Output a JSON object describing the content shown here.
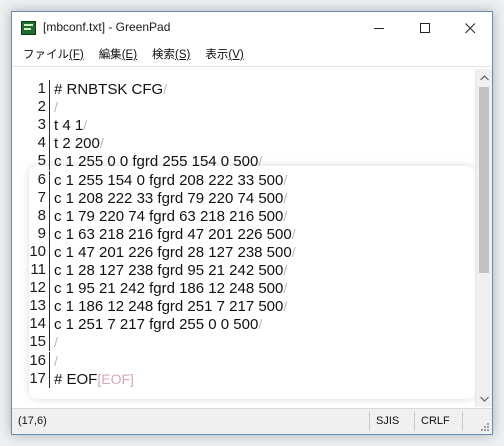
{
  "window": {
    "title": "[mbconf.txt] - GreenPad"
  },
  "menu": [
    {
      "label": "ファイル",
      "accel": "(F)"
    },
    {
      "label": "編集",
      "accel": "(E)"
    },
    {
      "label": "検索",
      "accel": "(S)"
    },
    {
      "label": "表示",
      "accel": "(V)"
    }
  ],
  "editor": {
    "lines": [
      {
        "num": "1",
        "text": "# RNBTSK CFG",
        "eol": "/"
      },
      {
        "num": "2",
        "text": "",
        "eol": "/"
      },
      {
        "num": "3",
        "text": "t 4 1",
        "eol": "/"
      },
      {
        "num": "4",
        "text": "t 2 200",
        "eol": "/"
      },
      {
        "num": "5",
        "text": "c 1 255 0 0 fgrd 255 154 0 500",
        "eol": "/"
      },
      {
        "num": "6",
        "text": "c 1 255 154 0 fgrd 208 222 33 500",
        "eol": "/"
      },
      {
        "num": "7",
        "text": "c 1 208 222 33 fgrd 79 220 74 500",
        "eol": "/"
      },
      {
        "num": "8",
        "text": "c 1 79 220 74 fgrd 63 218 216 500",
        "eol": "/"
      },
      {
        "num": "9",
        "text": "c 1 63 218 216 fgrd 47 201 226 500",
        "eol": "/"
      },
      {
        "num": "10",
        "text": "c 1 47 201 226 fgrd 28 127 238 500",
        "eol": "/"
      },
      {
        "num": "11",
        "text": "c 1 28 127 238 fgrd 95 21 242 500",
        "eol": "/"
      },
      {
        "num": "12",
        "text": "c 1 95 21 242 fgrd 186 12 248 500",
        "eol": "/"
      },
      {
        "num": "13",
        "text": "c 1 186 12 248 fgrd 251 7 217 500",
        "eol": "/"
      },
      {
        "num": "14",
        "text": "c 1 251 7 217 fgrd 255 0 0 500",
        "eol": "/"
      },
      {
        "num": "15",
        "text": "",
        "eol": "/"
      },
      {
        "num": "16",
        "text": "",
        "eol": "/"
      },
      {
        "num": "17",
        "text": "# EOF",
        "eol": "[EOF]"
      }
    ]
  },
  "status": {
    "position": "(17,6)",
    "encoding": "SJIS",
    "line_ending": "CRLF"
  },
  "colors": {
    "eol_marker": "#b8b8b8",
    "eof_marker": "#d4a8b4",
    "window_border": "#6a8bb0"
  }
}
